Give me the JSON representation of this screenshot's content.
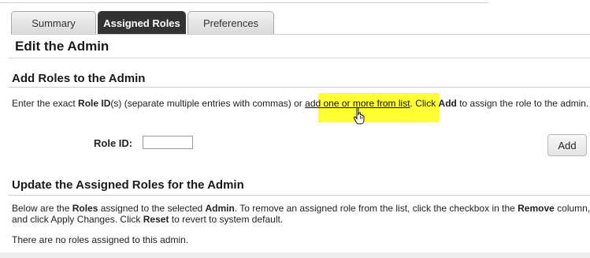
{
  "tabs": [
    {
      "label": "Summary",
      "active": false
    },
    {
      "label": "Assigned Roles",
      "active": true
    },
    {
      "label": "Preferences",
      "active": false
    }
  ],
  "page_title": "Edit the Admin",
  "add_section": {
    "heading": "Add Roles to the Admin",
    "text_1": "Enter the exact ",
    "bold_role_id": "Role ID",
    "text_2": "(s) (separate multiple entries with commas) or ",
    "link": "add one or more from list",
    "text_3": ". Click ",
    "bold_add": "Add",
    "text_4": " to assign the role to the admin.",
    "role_id_label": "Role ID:",
    "role_id_value": "",
    "add_button": "Add"
  },
  "update_section": {
    "heading": "Update the Assigned Roles for the Admin",
    "text_1": "Below are the ",
    "bold_roles": "Roles",
    "text_2": " assigned to the selected ",
    "bold_admin": "Admin",
    "text_3": ". To remove an assigned role from the list, click the checkbox in the ",
    "bold_remove": "Remove",
    "text_4": " column, and click Apply Changes. Click ",
    "bold_reset": "Reset",
    "text_5": " to revert to system default.",
    "empty_message": "There are no roles assigned to this admin."
  },
  "colors": {
    "highlight": "#ffff33",
    "active_tab": "#333333"
  },
  "icons": {
    "cursor": "hand-pointer-icon"
  }
}
